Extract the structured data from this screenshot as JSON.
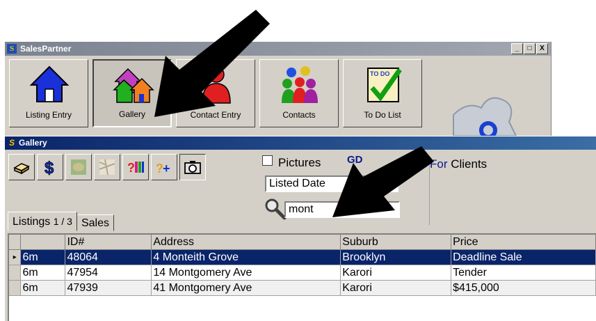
{
  "main_window": {
    "title": "SalesPartner",
    "window_buttons": [
      "_",
      "□",
      "X"
    ],
    "toolbar": [
      {
        "label": "Listing Entry",
        "icon": "house-icon"
      },
      {
        "label": "Gallery",
        "icon": "houses-icon",
        "active": true
      },
      {
        "label": "Contact Entry",
        "icon": "person-icon"
      },
      {
        "label": "Contacts",
        "icon": "people-icon"
      },
      {
        "label": "To Do List",
        "icon": "todo-check-icon",
        "icon_text": "TO DO"
      }
    ]
  },
  "gallery_window": {
    "title": "Gallery",
    "title_glyph": "S",
    "tools": [
      {
        "icon": "tray-icon"
      },
      {
        "icon": "dollar-icon"
      },
      {
        "icon": "map-icon"
      },
      {
        "icon": "street-map-icon"
      },
      {
        "icon": "question-bars-icon"
      },
      {
        "icon": "question-plus-icon"
      },
      {
        "icon": "camera-icon",
        "pressed": true
      }
    ],
    "pictures_label": "Pictures",
    "pictures_checked": false,
    "gd_label": "GD",
    "sort_value": "Listed Date",
    "search_value": "mont",
    "for_clients": {
      "prefix": "For",
      "rest": " Clients"
    },
    "tabs": [
      {
        "label": "Listings",
        "count": "1 / 3",
        "active": true
      },
      {
        "label": "Sales",
        "active": false
      }
    ],
    "grid": {
      "columns": [
        "",
        "ID#",
        "Address",
        "Suburb",
        "Price"
      ],
      "rows": [
        {
          "type": "6m",
          "id": "48064",
          "address": "4 Monteith Grove",
          "suburb": "Brooklyn",
          "price": "Deadline Sale",
          "selected": true
        },
        {
          "type": "6m",
          "id": "47954",
          "address": "14 Montgomery Ave",
          "suburb": "Karori",
          "price": "Tender"
        },
        {
          "type": "6m",
          "id": "47939",
          "address": "41 Montgomery Ave",
          "suburb": "Karori",
          "price": "$415,000"
        }
      ],
      "row_indicator": "▸"
    }
  },
  "colors": {
    "gallery_title_bg": "#0a246a",
    "selection": "#0a246a",
    "gd_text": "#0a1a8c"
  }
}
